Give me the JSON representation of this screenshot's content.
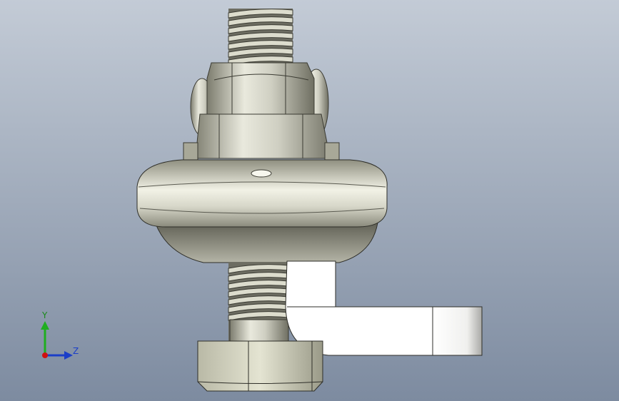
{
  "viewport": {
    "background_top": "#c3cbd6",
    "background_bottom": "#7d8ba0"
  },
  "triad": {
    "y_label": "Y",
    "z_label": "Z",
    "y_color": "#1fae1f",
    "z_color": "#1b3ec8",
    "x_color": "#d01010"
  },
  "parts": [
    "threaded-stud",
    "hex-upper-nut",
    "ball-socket-housing",
    "domed-washer",
    "l-bracket",
    "hex-lower-nut"
  ]
}
